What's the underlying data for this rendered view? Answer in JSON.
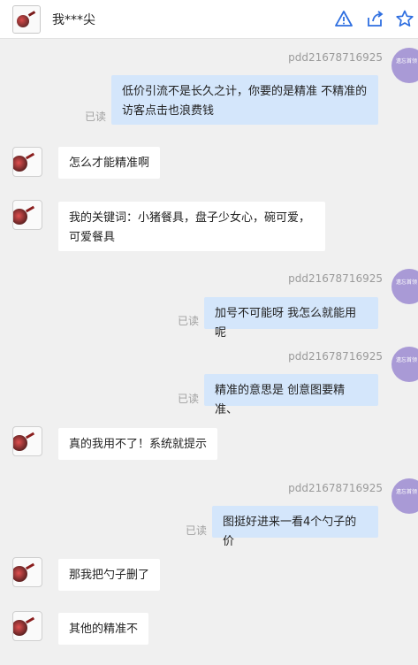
{
  "header": {
    "contact_name": "我***尖",
    "icons": [
      "warning-icon",
      "share-icon",
      "star-icon"
    ]
  },
  "messages": [
    {
      "side": "right",
      "sender": "pdd21678716925",
      "avatar_text": "遗忘首领",
      "text_lines": [
        "低价引流不是长久之计，你要的是精准 不精准的",
        "访客点击也浪费钱"
      ],
      "status": "已读"
    },
    {
      "side": "left",
      "text": "怎么才能精准啊"
    },
    {
      "side": "left",
      "text_lines": [
        "我的关键词：小猪餐具，盘子少女心，碗可爱，",
        "可爱餐具"
      ]
    },
    {
      "side": "right",
      "sender": "pdd21678716925",
      "avatar_text": "遗忘首领",
      "text": "加号不可能呀 我怎么就能用呢",
      "status": "已读"
    },
    {
      "side": "right",
      "sender": "pdd21678716925",
      "avatar_text": "遗忘首领",
      "text": "精准的意思是 创意图要精准、",
      "status": "已读"
    },
    {
      "side": "left",
      "text": "真的我用不了！系统就提示"
    },
    {
      "side": "right",
      "sender": "pdd21678716925",
      "avatar_text": "遗忘首领",
      "text": "图挺好进来一看4个勺子的价",
      "status": "已读"
    },
    {
      "side": "left",
      "text": "那我把勺子删了"
    },
    {
      "side": "left",
      "text": "其他的精准不"
    }
  ],
  "colors": {
    "right_bubble": "#d4e6fb",
    "left_bubble": "#ffffff",
    "background": "#f0f0f0",
    "icon_accent": "#2f6fe0",
    "sender_avatar": "#a99ad6"
  }
}
